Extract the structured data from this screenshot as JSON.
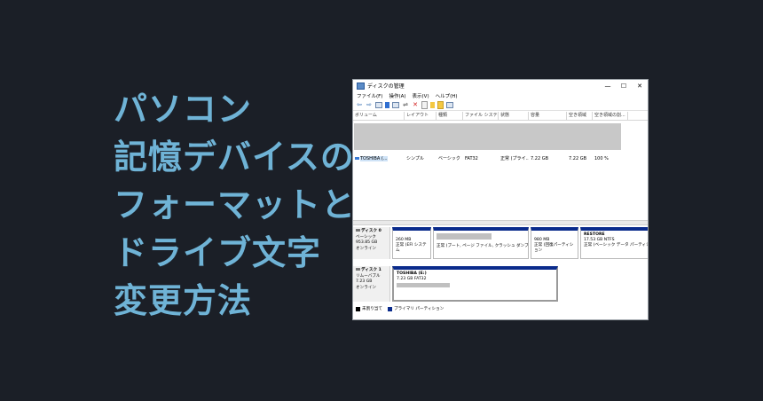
{
  "headline": {
    "lines": [
      "パソコン",
      "記憶デバイスの",
      "フォーマットと",
      "ドライブ文字",
      "変更方法"
    ]
  },
  "window": {
    "title": "ディスクの管理",
    "controls": {
      "minimize": "—",
      "maximize": "☐",
      "close": "✕"
    },
    "menu": [
      "ファイル(F)",
      "操作(A)",
      "表示(V)",
      "ヘルプ(H)"
    ],
    "columns": [
      "ボリューム",
      "レイアウト",
      "種類",
      "ファイル システム",
      "状態",
      "容量",
      "空き領域",
      "空き領域の割..."
    ],
    "rows": [
      {
        "volume": "TOSHIBA (...",
        "layout": "シンプル",
        "type": "ベーシック",
        "fs": "FAT32",
        "status": "正常 (プライ...",
        "capacity": "7.22 GB",
        "free": "7.22 GB",
        "pct": "100 %"
      }
    ],
    "disk0": {
      "name": "ディスク 0",
      "type": "ベーシック",
      "size": "953.85 GB",
      "state": "オンライン",
      "partitions": [
        {
          "name": "",
          "size": "260 MB",
          "status": "正常 (EFI システム"
        },
        {
          "name": "",
          "size": "",
          "status": "正常 (ブート, ページ ファイル, クラッシュ ダンプ, ベーシ"
        },
        {
          "name": "",
          "size": "980 MB",
          "status": "正常 (回復パーティション"
        },
        {
          "name": "RESTORE",
          "size": "17.53 GB NTFS",
          "status": "正常 (ベーシック データ パーティション"
        }
      ]
    },
    "disk1": {
      "name": "ディスク 1",
      "type": "リムーバブル",
      "size": "7.23 GB",
      "state": "オンライン",
      "partition": {
        "name": "TOSHIBA (E:)",
        "size": "7.23 GB FAT32"
      }
    },
    "legend": [
      {
        "label": "未割り当て",
        "color": "#000000"
      },
      {
        "label": "プライマリ パーティション",
        "color": "#0a2b8c"
      }
    ]
  }
}
